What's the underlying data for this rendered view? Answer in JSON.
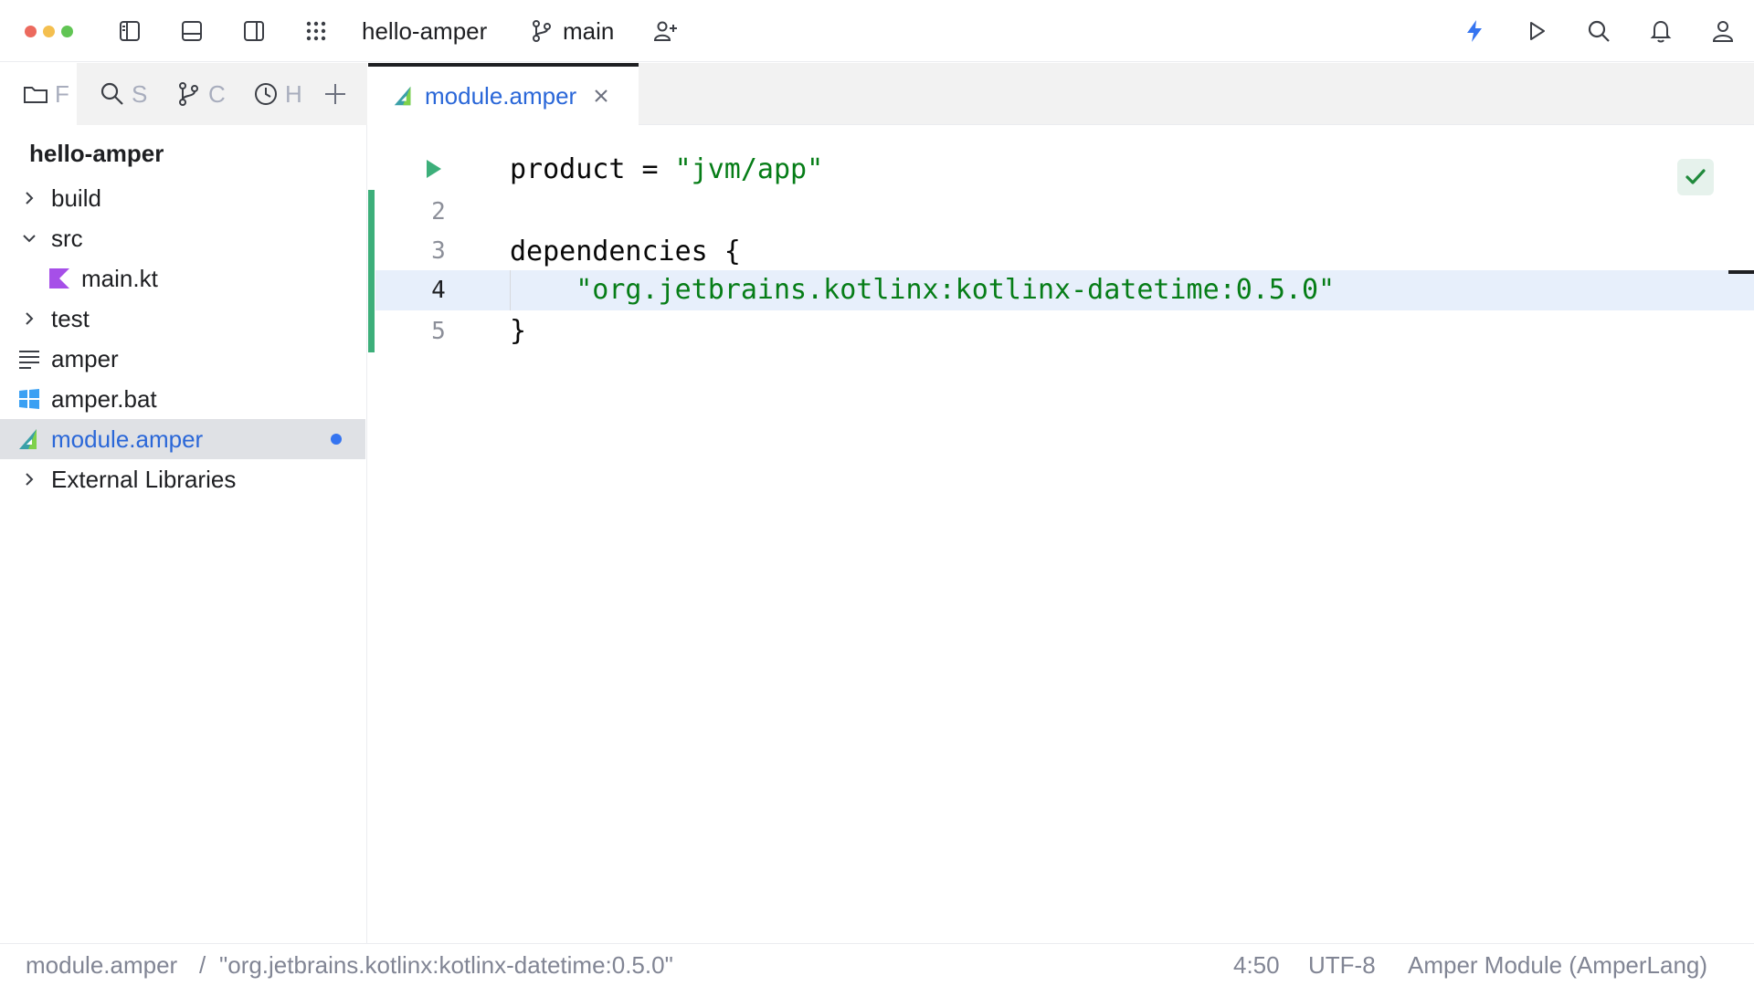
{
  "titlebar": {
    "project_name": "hello-amper",
    "branch": "main"
  },
  "tool_tabs": [
    {
      "icon": "folder-icon",
      "label": "F"
    },
    {
      "icon": "search-icon",
      "label": "S"
    },
    {
      "icon": "git-branch-icon",
      "label": "C"
    },
    {
      "icon": "clock-icon",
      "label": "H"
    }
  ],
  "project": {
    "root": "hello-amper",
    "items": [
      {
        "label": "build"
      },
      {
        "label": "src"
      },
      {
        "label": "main.kt"
      },
      {
        "label": "test"
      },
      {
        "label": "amper"
      },
      {
        "label": "amper.bat"
      },
      {
        "label": "module.amper"
      },
      {
        "label": "External Libraries"
      }
    ]
  },
  "editor": {
    "tab_label": "module.amper",
    "line_numbers": [
      "2",
      "3",
      "4",
      "5"
    ],
    "lines": {
      "l1_key": "product = ",
      "l1_value": "\"jvm/app\"",
      "l3": "dependencies {",
      "l4_indent": "    ",
      "l4_value": "\"org.jetbrains.kotlinx:kotlinx-datetime:0.5.0\"",
      "l5": "}"
    }
  },
  "status": {
    "breadcrumb_file": "module.amper",
    "breadcrumb_sep": "/",
    "breadcrumb_item": "\"org.jetbrains.kotlinx:kotlinx-datetime:0.5.0\"",
    "caret": "4:50",
    "encoding": "UTF-8",
    "file_type": "Amper Module (AmperLang)"
  },
  "colors": {
    "accent": "#3574f0",
    "selection": "#dfe1e5",
    "string": "#067d17",
    "changed": "#3daf7a",
    "kotlin": "#a64fe8",
    "windows": "#3aa0f3"
  }
}
